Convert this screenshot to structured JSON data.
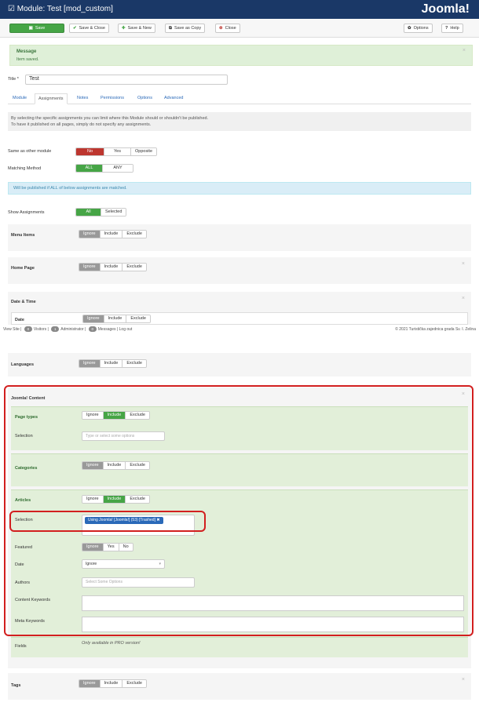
{
  "header": {
    "title": "Module: Test [mod_custom]",
    "logo_text": "Joomla!"
  },
  "toolbar": {
    "save": "Save",
    "save_close": "Save & Close",
    "save_new": "Save & New",
    "save_copy": "Save as Copy",
    "close": "Close",
    "options": "Options",
    "help": "Help"
  },
  "message": {
    "heading": "Message",
    "text": "Item saved."
  },
  "title_field": {
    "label": "Title *",
    "value": "Test"
  },
  "tabs": [
    "Module",
    "Assignments",
    "Notes",
    "Permissions",
    "Options",
    "Advanced"
  ],
  "note": {
    "line1": "By selecting the specific assignments you can limit where this Module should or shouldn't be published.",
    "line2": "To have it published on all pages, simply do not specify any assignments."
  },
  "same_as": {
    "label": "Same as other module",
    "options": [
      "No",
      "Yes",
      "Opposite"
    ]
  },
  "matching": {
    "label": "Matching Method",
    "options": [
      "ALL",
      "ANY"
    ]
  },
  "info_text": "Will be published if ALL of below assignments are matched.",
  "show_assign": {
    "label": "Show Assignments",
    "options": [
      "All",
      "Selected"
    ]
  },
  "iie": [
    "Ignore",
    "Include",
    "Exclude"
  ],
  "sections": {
    "menu": "Menu Items",
    "home": "Home Page",
    "datetime": "Date & Time",
    "date": "Date",
    "languages": "Languages",
    "joomla": "Joomla! Content",
    "tags": "Tags"
  },
  "status_bar": {
    "view_site": "View Site",
    "visitors": "Visitors",
    "admins": "Administrator",
    "messages": "Messages",
    "logout": "Log out",
    "visitors_count": "0",
    "admins_count": "1",
    "messages_count": "0",
    "copyright": "© 2021 Turistička zajednica grada Sv. I. Zelina"
  },
  "content": {
    "page_types": "Page types",
    "selection": "Selection",
    "selection_placeholder": "Type or select some options",
    "categories": "Categories",
    "articles": "Articles",
    "art_selection": "Selection",
    "chip": "Using Joomla! [Joomla!] (53) [Trashed]",
    "featured": "Featured",
    "featured_opts": [
      "Ignore",
      "Yes",
      "No"
    ],
    "date": "Date",
    "date_value": "Ignore",
    "authors": "Authors",
    "authors_placeholder": "Select Some Options",
    "content_kw": "Content Keywords",
    "meta_kw": "Meta Keywords",
    "fields": "Fields",
    "fields_note": "Only available in PRO version!"
  },
  "colors": {
    "header": "#1a3867",
    "green": "#46a546",
    "red": "#bd362f",
    "highlight": "#d21f1f"
  }
}
